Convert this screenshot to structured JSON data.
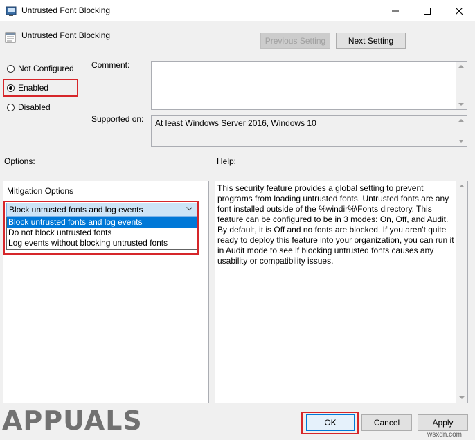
{
  "window": {
    "title": "Untrusted Font Blocking",
    "header_title": "Untrusted Font Blocking"
  },
  "nav": {
    "previous_label": "Previous Setting",
    "next_label": "Next Setting"
  },
  "state": {
    "options": [
      {
        "label": "Not Configured",
        "checked": false
      },
      {
        "label": "Enabled",
        "checked": true
      },
      {
        "label": "Disabled",
        "checked": false
      }
    ]
  },
  "comment": {
    "label": "Comment:",
    "value": ""
  },
  "supported": {
    "label": "Supported on:",
    "value": "At least Windows Server 2016, Windows 10"
  },
  "options_panel": {
    "label": "Options:",
    "group_label": "Mitigation Options",
    "selected": "Block untrusted fonts and log events",
    "items": [
      "Block untrusted fonts and log events",
      "Do not block untrusted fonts",
      "Log events without blocking untrusted fonts"
    ]
  },
  "help_panel": {
    "label": "Help:",
    "text": "This security feature provides a global setting to prevent programs from loading untrusted fonts. Untrusted fonts are any font installed outside of the %windir%\\Fonts directory. This feature can be configured to be in 3 modes: On, Off, and Audit. By default, it is Off and no fonts are blocked. If you aren't quite ready to deploy this feature into your organization, you can run it in Audit mode to see if blocking untrusted fonts causes any usability or compatibility issues."
  },
  "footer": {
    "ok_label": "OK",
    "cancel_label": "Cancel",
    "apply_label": "Apply"
  },
  "watermark": {
    "brand": "APPUALS",
    "site": "wsxdn.com"
  },
  "colors": {
    "highlight_red": "#d6262a",
    "selection_blue": "#0078d7"
  }
}
